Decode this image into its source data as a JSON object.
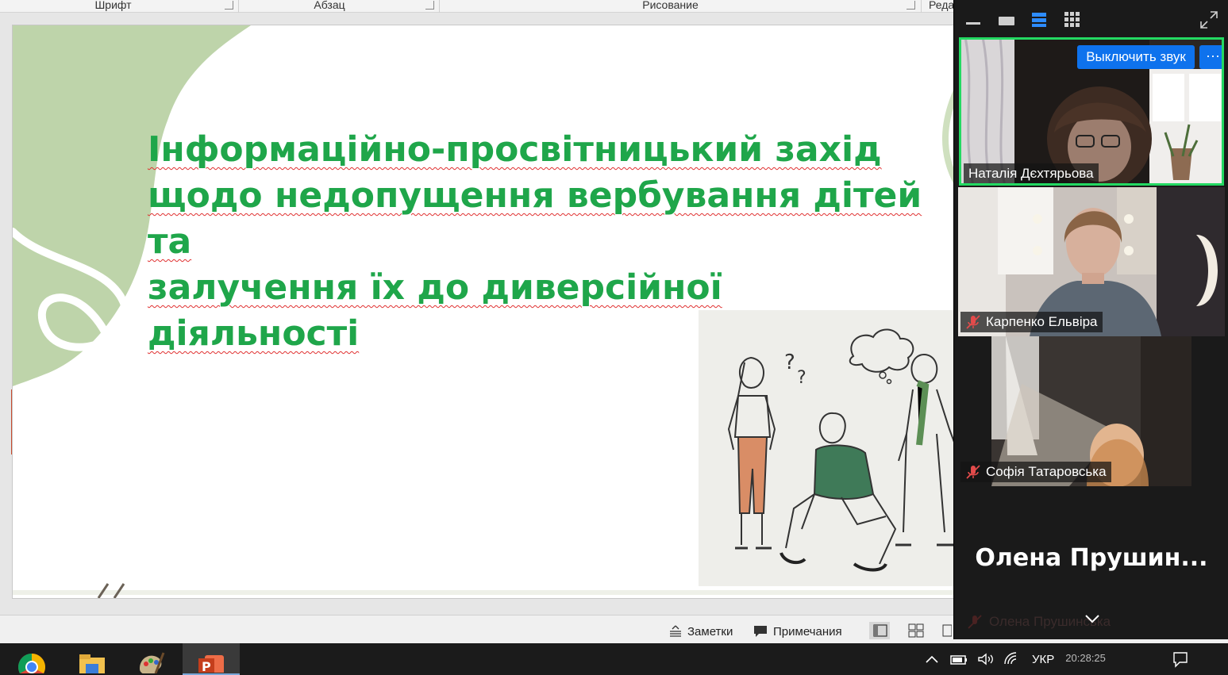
{
  "ribbon": {
    "groups": [
      "Шрифт",
      "Абзац",
      "Рисование",
      "Редактирование"
    ]
  },
  "slide": {
    "title_lines": [
      "Інформаційно-просвітницький захід",
      "щодо недопущення вербування дітей",
      "та",
      "залучення їх до диверсійної",
      "діяльності"
    ],
    "title_color": "#1fa64a"
  },
  "statusbar": {
    "notes_label": "Заметки",
    "comments_label": "Примечания"
  },
  "zoom": {
    "unmute_label": "Выключить звук",
    "more_label": "···",
    "participants": [
      {
        "name": "Наталія Дєхтярьова",
        "muted": false
      },
      {
        "name": "Карпенко Ельвіра",
        "muted": true
      },
      {
        "name": "Софія Татаровська",
        "muted": true
      },
      {
        "name": "Олена Прушинська",
        "muted": true
      }
    ],
    "big_name": "Олена  Прушин...",
    "active_speaker_color": "#23d962"
  },
  "taskbar": {
    "language": "УКР",
    "clock": "20:28:25"
  }
}
